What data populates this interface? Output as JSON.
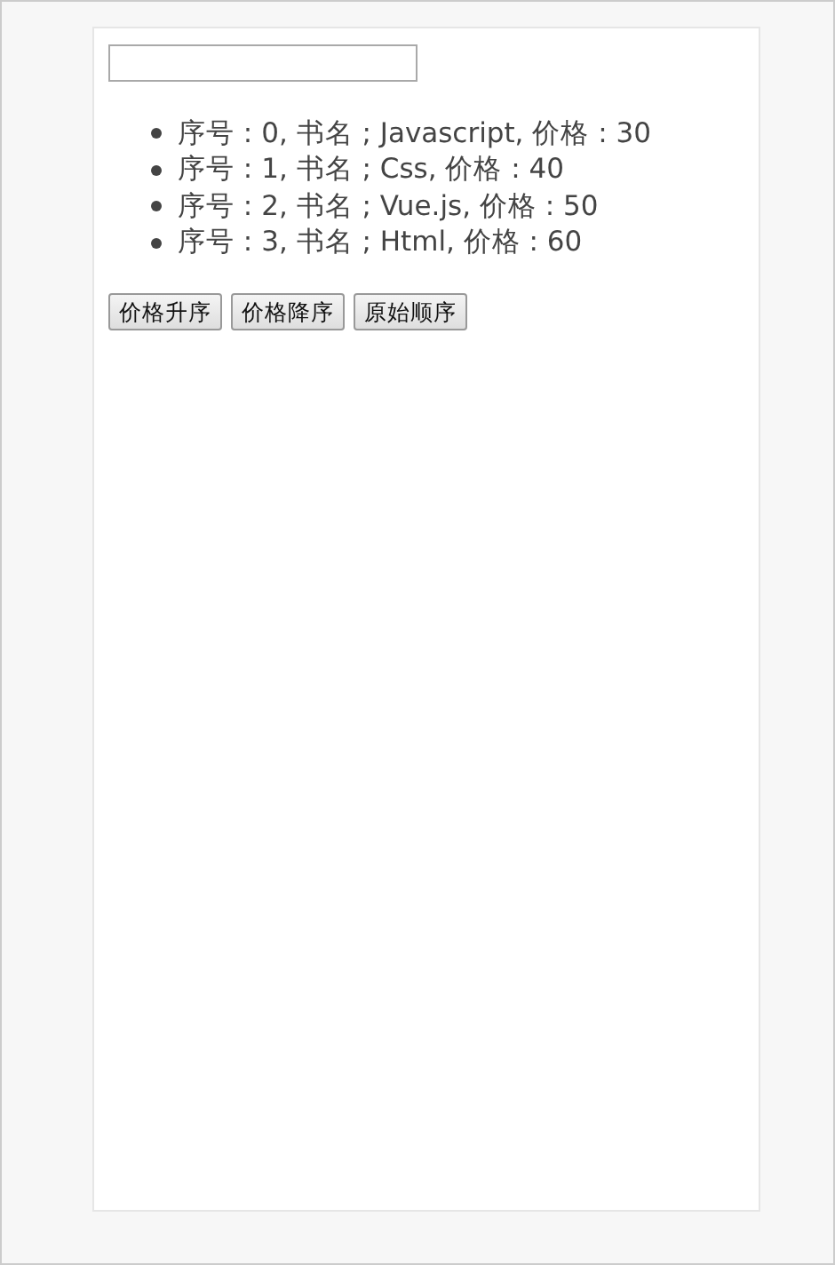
{
  "books": [
    {
      "text": "序号 : 0, 书名 ; Javascript, 价格 : 30"
    },
    {
      "text": "序号 : 1, 书名 ; Css, 价格 : 40"
    },
    {
      "text": "序号 : 2, 书名 ; Vue.js, 价格 : 50"
    },
    {
      "text": "序号 : 3, 书名 ; Html, 价格 : 60"
    }
  ],
  "buttons": [
    "价格升序",
    "价格降序",
    "原始顺序"
  ]
}
